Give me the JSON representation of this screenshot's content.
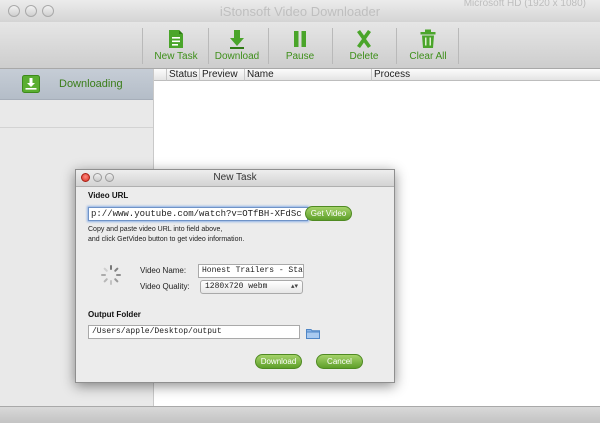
{
  "window": {
    "title": "iStonsoft Video Downloader",
    "menu_extra": "Microsoft HD (1920 x 1080)"
  },
  "toolbar": {
    "new_task": "New Task",
    "download": "Download",
    "pause": "Pause",
    "delete": "Delete",
    "clear_all": "Clear All",
    "accent_color": "#3e8f1a"
  },
  "sidebar": {
    "items": [
      {
        "label": "Downloading",
        "icon": "download-tray-icon",
        "selected": true
      }
    ]
  },
  "table": {
    "columns": [
      "",
      "Status",
      "Preview",
      "Name",
      "Process"
    ]
  },
  "dialog": {
    "title": "New Task",
    "video_url_label": "Video URL",
    "url_value": "p://www.youtube.com/watch?v=OTfBH-XFdSc",
    "get_video_label": "Get Video",
    "help_line1": "Copy and paste video URL into field above,",
    "help_line2": "and click GetVideo button to get video information.",
    "video_name_label": "Video Name:",
    "video_name_value": "Honest Trailers - Star T",
    "video_quality_label": "Video Quality:",
    "video_quality_value": "1280x720 webm",
    "output_folder_label": "Output Folder",
    "output_path": "/Users/apple/Desktop/output",
    "download_label": "Download",
    "cancel_label": "Cancel"
  }
}
